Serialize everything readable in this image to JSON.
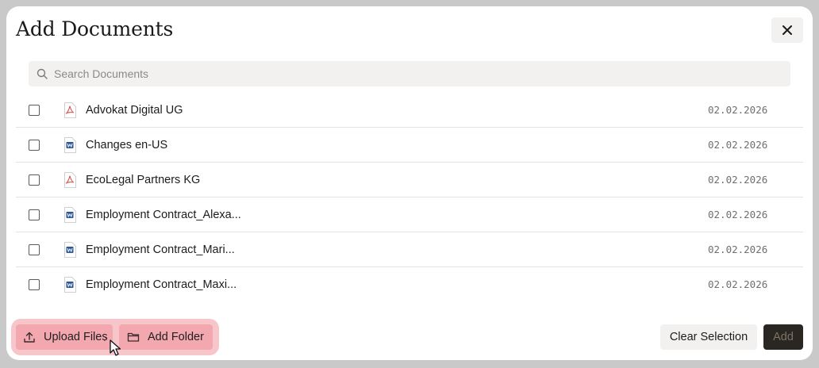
{
  "dialog": {
    "title": "Add Documents",
    "close_icon": "close-icon"
  },
  "search": {
    "placeholder": "Search Documents",
    "value": "",
    "icon": "search-icon"
  },
  "documents": [
    {
      "name": "Advokat Digital UG",
      "date": "02.02.2026",
      "type": "pdf",
      "checked": false
    },
    {
      "name": "Changes en-US",
      "date": "02.02.2026",
      "type": "word",
      "checked": false
    },
    {
      "name": "EcoLegal Partners KG",
      "date": "02.02.2026",
      "type": "pdf",
      "checked": false
    },
    {
      "name": "Employment Contract_Alexa...",
      "date": "02.02.2026",
      "type": "word",
      "checked": false
    },
    {
      "name": "Employment Contract_Mari...",
      "date": "02.02.2026",
      "type": "word",
      "checked": false
    },
    {
      "name": "Employment Contract_Maxi...",
      "date": "02.02.2026",
      "type": "word",
      "checked": false
    }
  ],
  "footer": {
    "upload_label": "Upload Files",
    "add_folder_label": "Add Folder",
    "clear_label": "Clear Selection",
    "add_label": "Add"
  },
  "colors": {
    "pdf_icon": "#d9534f",
    "word_icon": "#2b579a",
    "highlight": "#f6c6ca",
    "primary_button": "#2a2622"
  }
}
